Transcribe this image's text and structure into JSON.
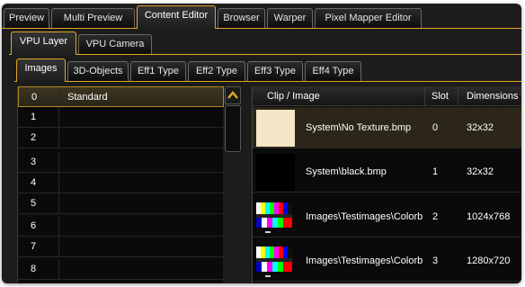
{
  "top_tabs": [
    {
      "label": "Preview"
    },
    {
      "label": "Multi Preview"
    },
    {
      "label": "Content Editor"
    },
    {
      "label": "Browser"
    },
    {
      "label": "Warper"
    },
    {
      "label": "Pixel Mapper Editor"
    }
  ],
  "layer_tabs": [
    {
      "label": "VPU Layer"
    },
    {
      "label": "VPU Camera"
    }
  ],
  "type_tabs": [
    {
      "label": "Images"
    },
    {
      "label": "3D-Objects"
    },
    {
      "label": "Eff1 Type"
    },
    {
      "label": "Eff2 Type"
    },
    {
      "label": "Eff3 Type"
    },
    {
      "label": "Eff4 Type"
    }
  ],
  "active": {
    "top_tab": "Content Editor",
    "layer_tab": "VPU Layer",
    "type_tab": "Images"
  },
  "image_list": [
    {
      "num": "0",
      "name": "Standard"
    },
    {
      "num": "1",
      "name": ""
    },
    {
      "num": "2",
      "name": ""
    },
    {
      "num": "3",
      "name": ""
    },
    {
      "num": "4",
      "name": ""
    },
    {
      "num": "5",
      "name": ""
    },
    {
      "num": "6",
      "name": ""
    },
    {
      "num": "7",
      "name": ""
    },
    {
      "num": "8",
      "name": ""
    }
  ],
  "table": {
    "headers": {
      "clip": "Clip / Image",
      "slot": "Slot",
      "dimensions": "Dimensions"
    },
    "rows": [
      {
        "thumbnail": "cream-swatch",
        "clip": "System\\No Texture.bmp",
        "slot": "0",
        "dimensions": "32x32"
      },
      {
        "thumbnail": "black-swatch",
        "clip": "System\\black.bmp",
        "slot": "1",
        "dimensions": "32x32"
      },
      {
        "thumbnail": "colorbar-thumbnail",
        "clip": "Images\\Testimages\\Colorbar",
        "slot": "2",
        "dimensions": "1024x768"
      },
      {
        "thumbnail": "colorbar-thumbnail",
        "clip": "Images\\Testimages\\Colorbar",
        "slot": "3",
        "dimensions": "1280x720"
      }
    ]
  },
  "scroll_up_icon": "chevron-up-icon",
  "colors": {
    "accent": "#e0a820",
    "background": "#1c1c1c",
    "selected_row": "#2b2617",
    "no_texture": "#f5e6c8"
  }
}
